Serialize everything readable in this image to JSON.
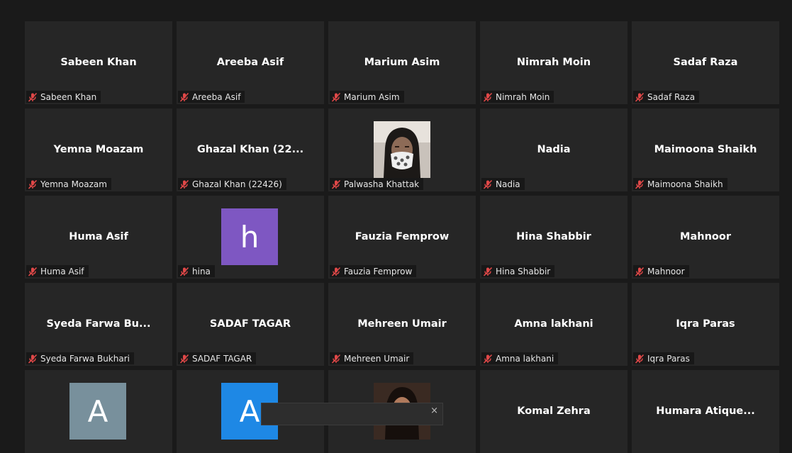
{
  "gallery": {
    "tiles": [
      {
        "display_name": "Sabeen Khan",
        "tag": "Sabeen Khan"
      },
      {
        "display_name": "Areeba Asif",
        "tag": "Areeba Asif"
      },
      {
        "display_name": "Marium Asim",
        "tag": "Marium Asim"
      },
      {
        "display_name": "Nimrah Moin",
        "tag": "Nimrah Moin"
      },
      {
        "display_name": "Sadaf Raza",
        "tag": "Sadaf Raza"
      },
      {
        "display_name": "Yemna Moazam",
        "tag": "Yemna Moazam"
      },
      {
        "display_name": "Ghazal Khan (22...",
        "tag": "Ghazal Khan (22426)"
      },
      {
        "photo": "masked-woman",
        "tag": "Palwasha Khattak"
      },
      {
        "display_name": "Nadia",
        "tag": "Nadia"
      },
      {
        "display_name": "Maimoona Shaikh",
        "tag": "Maimoona Shaikh"
      },
      {
        "display_name": "Huma Asif",
        "tag": "Huma Asif"
      },
      {
        "avatar_letter": "h",
        "avatar_color": "#7e57c2",
        "tag": "hina"
      },
      {
        "display_name": "Fauzia Femprow",
        "tag": "Fauzia Femprow"
      },
      {
        "display_name": "Hina Shabbir",
        "tag": "Hina Shabbir"
      },
      {
        "display_name": "Mahnoor",
        "tag": "Mahnoor"
      },
      {
        "display_name": "Syeda Farwa Bu...",
        "tag": "Syeda Farwa Bukhari"
      },
      {
        "display_name": "SADAF TAGAR",
        "tag": "SADAF TAGAR"
      },
      {
        "display_name": "Mehreen Umair",
        "tag": "Mehreen Umair"
      },
      {
        "display_name": "Amna lakhani",
        "tag": "Amna lakhani"
      },
      {
        "display_name": "Iqra Paras",
        "tag": "Iqra Paras"
      },
      {
        "avatar_letter": "A",
        "avatar_color": "#78909c"
      },
      {
        "avatar_letter": "A",
        "avatar_color": "#1e88e5"
      },
      {
        "photo": "woman-portrait"
      },
      {
        "display_name": "Komal Zehra"
      },
      {
        "display_name": "Humara  Atique..."
      }
    ]
  },
  "popup": {
    "close_glyph": "×"
  },
  "colors": {
    "background": "#1a1a1a",
    "tile": "#262626",
    "muted_icon": "#e04848"
  }
}
